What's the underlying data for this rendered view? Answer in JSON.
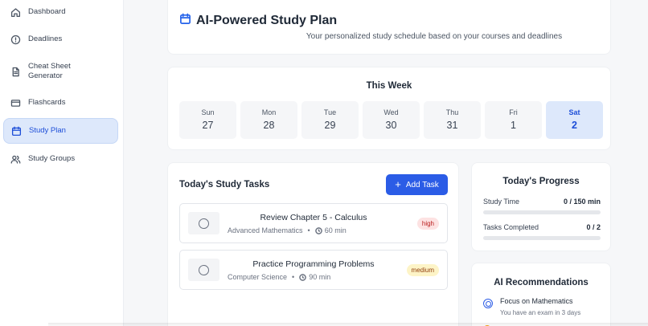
{
  "sidebar": {
    "items": [
      {
        "label": "Dashboard",
        "icon": "home-icon"
      },
      {
        "label": "Deadlines",
        "icon": "alert-circle-icon"
      },
      {
        "label": "Cheat Sheet Generator",
        "icon": "document-icon"
      },
      {
        "label": "Flashcards",
        "icon": "card-icon"
      },
      {
        "label": "Study Plan",
        "icon": "calendar-icon",
        "active": true
      },
      {
        "label": "Study Groups",
        "icon": "users-icon"
      }
    ]
  },
  "header": {
    "title": "AI-Powered Study Plan",
    "subtitle": "Your personalized study schedule based on your courses and deadlines"
  },
  "week": {
    "title": "This Week",
    "days": [
      {
        "name": "Sun",
        "date": "27"
      },
      {
        "name": "Mon",
        "date": "28"
      },
      {
        "name": "Tue",
        "date": "29"
      },
      {
        "name": "Wed",
        "date": "30"
      },
      {
        "name": "Thu",
        "date": "31"
      },
      {
        "name": "Fri",
        "date": "1"
      },
      {
        "name": "Sat",
        "date": "2",
        "selected": true
      }
    ]
  },
  "tasks": {
    "title": "Today's Study Tasks",
    "add_label": "Add Task",
    "items": [
      {
        "name": "Review Chapter 5 - Calculus",
        "course": "Advanced Mathematics",
        "duration": "60 min",
        "priority": "high"
      },
      {
        "name": "Practice Programming Problems",
        "course": "Computer Science",
        "duration": "90 min",
        "priority": "medium"
      }
    ]
  },
  "progress": {
    "title": "Today's Progress",
    "study_time_label": "Study Time",
    "study_time_value": "0 / 150 min",
    "study_time_fraction": 0,
    "tasks_label": "Tasks Completed",
    "tasks_value": "0 / 2",
    "tasks_fraction": 0
  },
  "recommendations": {
    "title": "AI Recommendations",
    "items": [
      {
        "title": "Focus on Mathematics",
        "desc": "You have an exam in 3 days"
      }
    ]
  },
  "colors": {
    "accent": "#2b5ce6",
    "active_bg": "#dde8fb",
    "high": "#fde2e2",
    "medium": "#fdf4c7"
  }
}
